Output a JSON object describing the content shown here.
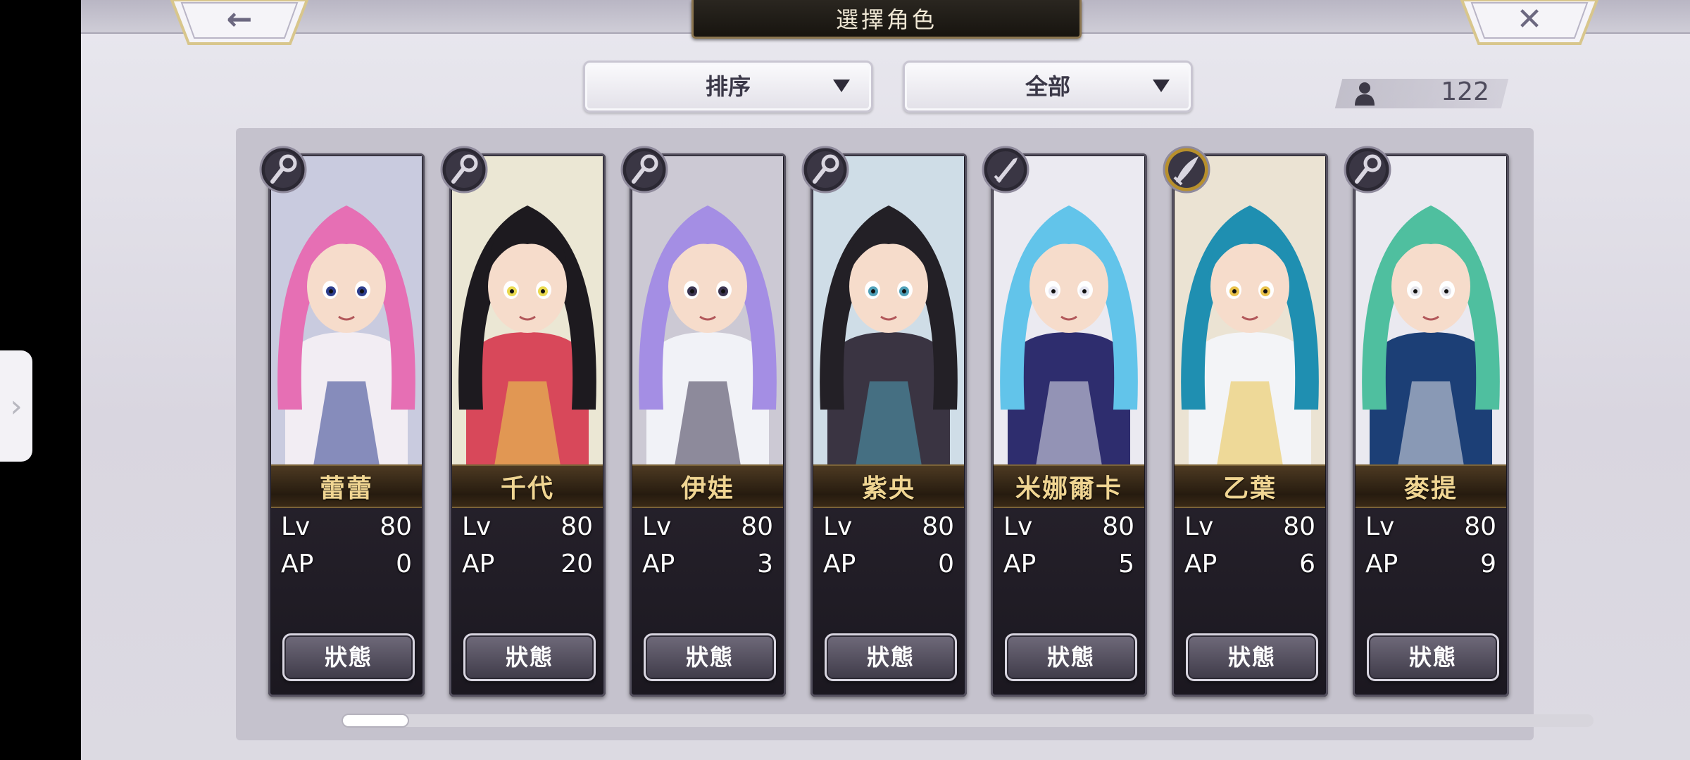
{
  "header": {
    "title": "選擇角色",
    "back_label": "←",
    "close_label": "✕"
  },
  "filters": {
    "sort_label": "排序",
    "category_label": "全部"
  },
  "roster": {
    "count": "122"
  },
  "stat_labels": {
    "lv": "Lv",
    "ap": "AP"
  },
  "characters": [
    {
      "name": "蕾蕾",
      "lv": "80",
      "ap": "0",
      "status_label": "狀態",
      "class_icon": "staff-icon",
      "hair": "#e66fb4",
      "outfit": "#f2edf3",
      "accent": "#2d3d8c"
    },
    {
      "name": "千代",
      "lv": "80",
      "ap": "20",
      "status_label": "狀態",
      "class_icon": "staff-icon",
      "hair": "#1d1a1f",
      "outfit": "#d8485a",
      "accent": "#e9d94e"
    },
    {
      "name": "伊娃",
      "lv": "80",
      "ap": "3",
      "status_label": "狀態",
      "class_icon": "staff-icon",
      "hair": "#a48ee4",
      "outfit": "#f1f2f7",
      "accent": "#3b3450"
    },
    {
      "name": "紫央",
      "lv": "80",
      "ap": "0",
      "status_label": "狀態",
      "class_icon": "staff-icon",
      "hair": "#232026",
      "outfit": "#3a3442",
      "accent": "#4fa0b8"
    },
    {
      "name": "米娜爾卡",
      "lv": "80",
      "ap": "5",
      "status_label": "狀態",
      "class_icon": "sword-icon",
      "hair": "#62c4ea",
      "outfit": "#2e2d6e",
      "accent": "#e7e7f1"
    },
    {
      "name": "乙葉",
      "lv": "80",
      "ap": "6",
      "status_label": "狀態",
      "class_icon": "blade-icon",
      "hair": "#1f8fb1",
      "outfit": "#f3f4f7",
      "accent": "#e9c24a"
    },
    {
      "name": "麥提",
      "lv": "80",
      "ap": "9",
      "status_label": "狀態",
      "class_icon": "staff-icon",
      "hair": "#4fbf9f",
      "outfit": "#1c3f76",
      "accent": "#e4e4ea"
    }
  ]
}
